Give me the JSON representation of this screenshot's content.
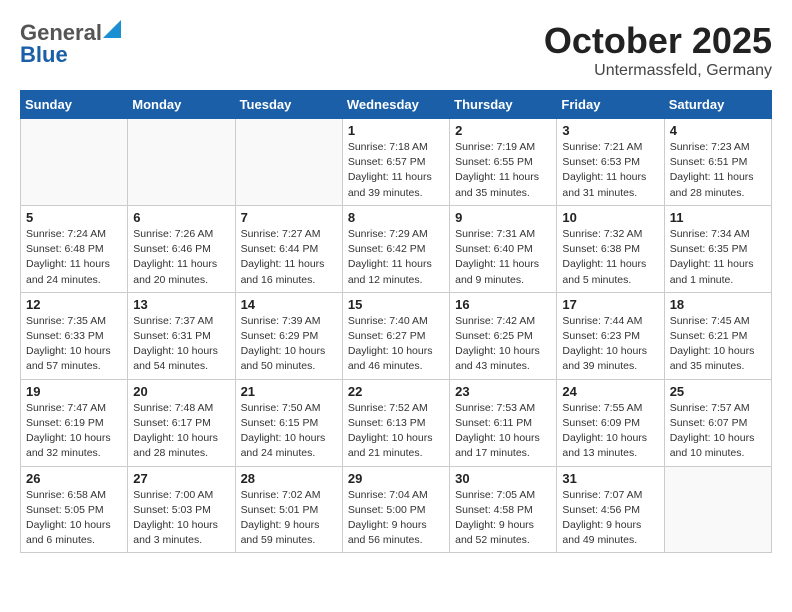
{
  "header": {
    "logo_general": "General",
    "logo_blue": "Blue",
    "month": "October 2025",
    "location": "Untermassfeld, Germany"
  },
  "weekdays": [
    "Sunday",
    "Monday",
    "Tuesday",
    "Wednesday",
    "Thursday",
    "Friday",
    "Saturday"
  ],
  "weeks": [
    [
      {
        "day": "",
        "info": ""
      },
      {
        "day": "",
        "info": ""
      },
      {
        "day": "",
        "info": ""
      },
      {
        "day": "1",
        "info": "Sunrise: 7:18 AM\nSunset: 6:57 PM\nDaylight: 11 hours and 39 minutes."
      },
      {
        "day": "2",
        "info": "Sunrise: 7:19 AM\nSunset: 6:55 PM\nDaylight: 11 hours and 35 minutes."
      },
      {
        "day": "3",
        "info": "Sunrise: 7:21 AM\nSunset: 6:53 PM\nDaylight: 11 hours and 31 minutes."
      },
      {
        "day": "4",
        "info": "Sunrise: 7:23 AM\nSunset: 6:51 PM\nDaylight: 11 hours and 28 minutes."
      }
    ],
    [
      {
        "day": "5",
        "info": "Sunrise: 7:24 AM\nSunset: 6:48 PM\nDaylight: 11 hours and 24 minutes."
      },
      {
        "day": "6",
        "info": "Sunrise: 7:26 AM\nSunset: 6:46 PM\nDaylight: 11 hours and 20 minutes."
      },
      {
        "day": "7",
        "info": "Sunrise: 7:27 AM\nSunset: 6:44 PM\nDaylight: 11 hours and 16 minutes."
      },
      {
        "day": "8",
        "info": "Sunrise: 7:29 AM\nSunset: 6:42 PM\nDaylight: 11 hours and 12 minutes."
      },
      {
        "day": "9",
        "info": "Sunrise: 7:31 AM\nSunset: 6:40 PM\nDaylight: 11 hours and 9 minutes."
      },
      {
        "day": "10",
        "info": "Sunrise: 7:32 AM\nSunset: 6:38 PM\nDaylight: 11 hours and 5 minutes."
      },
      {
        "day": "11",
        "info": "Sunrise: 7:34 AM\nSunset: 6:35 PM\nDaylight: 11 hours and 1 minute."
      }
    ],
    [
      {
        "day": "12",
        "info": "Sunrise: 7:35 AM\nSunset: 6:33 PM\nDaylight: 10 hours and 57 minutes."
      },
      {
        "day": "13",
        "info": "Sunrise: 7:37 AM\nSunset: 6:31 PM\nDaylight: 10 hours and 54 minutes."
      },
      {
        "day": "14",
        "info": "Sunrise: 7:39 AM\nSunset: 6:29 PM\nDaylight: 10 hours and 50 minutes."
      },
      {
        "day": "15",
        "info": "Sunrise: 7:40 AM\nSunset: 6:27 PM\nDaylight: 10 hours and 46 minutes."
      },
      {
        "day": "16",
        "info": "Sunrise: 7:42 AM\nSunset: 6:25 PM\nDaylight: 10 hours and 43 minutes."
      },
      {
        "day": "17",
        "info": "Sunrise: 7:44 AM\nSunset: 6:23 PM\nDaylight: 10 hours and 39 minutes."
      },
      {
        "day": "18",
        "info": "Sunrise: 7:45 AM\nSunset: 6:21 PM\nDaylight: 10 hours and 35 minutes."
      }
    ],
    [
      {
        "day": "19",
        "info": "Sunrise: 7:47 AM\nSunset: 6:19 PM\nDaylight: 10 hours and 32 minutes."
      },
      {
        "day": "20",
        "info": "Sunrise: 7:48 AM\nSunset: 6:17 PM\nDaylight: 10 hours and 28 minutes."
      },
      {
        "day": "21",
        "info": "Sunrise: 7:50 AM\nSunset: 6:15 PM\nDaylight: 10 hours and 24 minutes."
      },
      {
        "day": "22",
        "info": "Sunrise: 7:52 AM\nSunset: 6:13 PM\nDaylight: 10 hours and 21 minutes."
      },
      {
        "day": "23",
        "info": "Sunrise: 7:53 AM\nSunset: 6:11 PM\nDaylight: 10 hours and 17 minutes."
      },
      {
        "day": "24",
        "info": "Sunrise: 7:55 AM\nSunset: 6:09 PM\nDaylight: 10 hours and 13 minutes."
      },
      {
        "day": "25",
        "info": "Sunrise: 7:57 AM\nSunset: 6:07 PM\nDaylight: 10 hours and 10 minutes."
      }
    ],
    [
      {
        "day": "26",
        "info": "Sunrise: 6:58 AM\nSunset: 5:05 PM\nDaylight: 10 hours and 6 minutes."
      },
      {
        "day": "27",
        "info": "Sunrise: 7:00 AM\nSunset: 5:03 PM\nDaylight: 10 hours and 3 minutes."
      },
      {
        "day": "28",
        "info": "Sunrise: 7:02 AM\nSunset: 5:01 PM\nDaylight: 9 hours and 59 minutes."
      },
      {
        "day": "29",
        "info": "Sunrise: 7:04 AM\nSunset: 5:00 PM\nDaylight: 9 hours and 56 minutes."
      },
      {
        "day": "30",
        "info": "Sunrise: 7:05 AM\nSunset: 4:58 PM\nDaylight: 9 hours and 52 minutes."
      },
      {
        "day": "31",
        "info": "Sunrise: 7:07 AM\nSunset: 4:56 PM\nDaylight: 9 hours and 49 minutes."
      },
      {
        "day": "",
        "info": ""
      }
    ]
  ]
}
